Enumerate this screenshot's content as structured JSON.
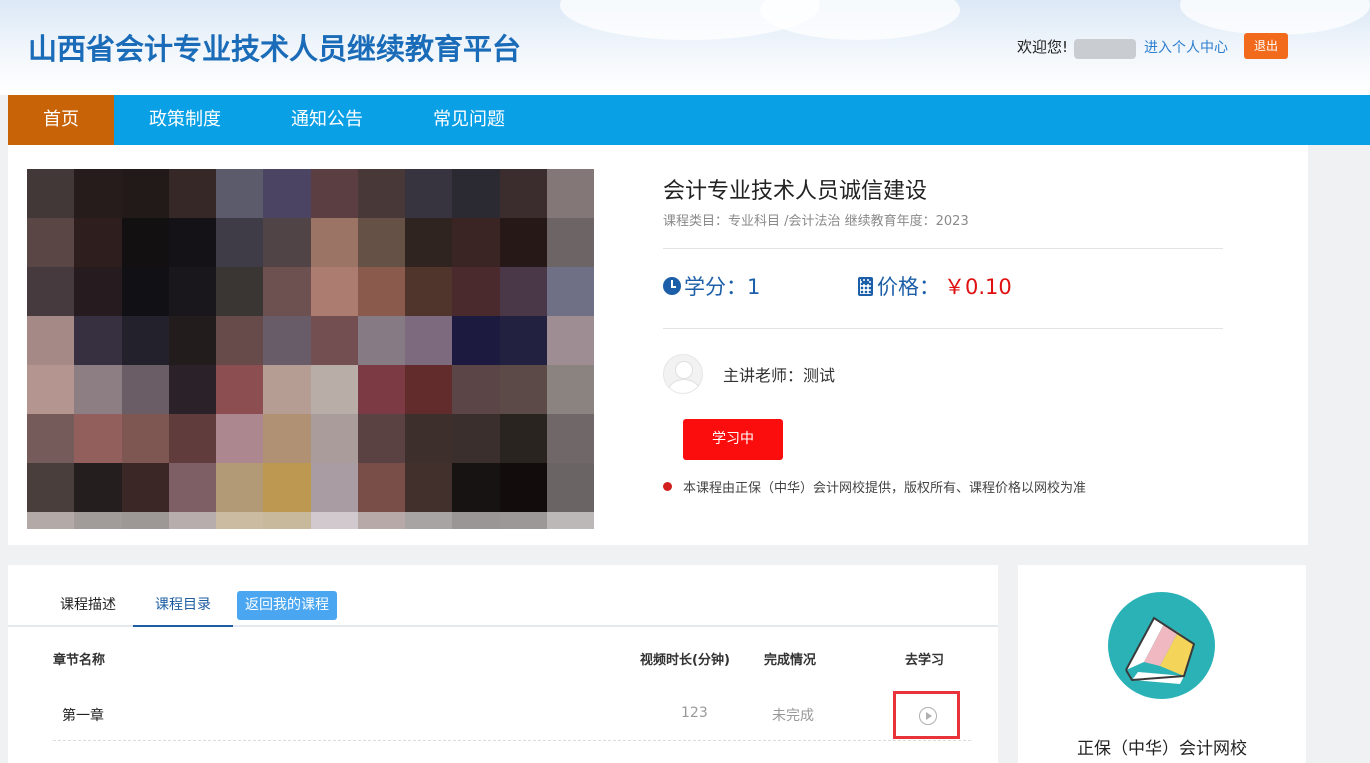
{
  "header": {
    "site_title": "山西省会计专业技术人员继续教育平台",
    "welcome": "欢迎您!",
    "user_center_link": "进入个人中心",
    "logout_label": "退出"
  },
  "nav": {
    "items": [
      {
        "label": "首页",
        "active": true
      },
      {
        "label": "政策制度",
        "active": false
      },
      {
        "label": "通知公告",
        "active": false
      },
      {
        "label": "常见问题",
        "active": false
      }
    ]
  },
  "course": {
    "title": "会计专业技术人员诚信建设",
    "meta": "课程类目：专业科目 /会计法治  继续教育年度：2023",
    "credit_label": "学分：1",
    "price_label": "价格：",
    "price_value": "￥0.10",
    "teacher": "主讲老师：测试",
    "study_button": "学习中",
    "notice": "本课程由正保（中华）会计网校提供，版权所有、课程价格以网校为准",
    "thumbnail_colors": [
      "#423838",
      "#251c1b",
      "#221a19",
      "#352827",
      "#5c5b6b",
      "#4b4463",
      "#5b3e41",
      "#483837",
      "#373440",
      "#2b2a33",
      "#3b2d2e",
      "#837877",
      "#5b4646",
      "#2e1e1e",
      "#121011",
      "#141216",
      "#3f3b47",
      "#514446",
      "#9b7465",
      "#665146",
      "#2f2420",
      "#3a2424",
      "#261817",
      "#6d6565",
      "#473a3f",
      "#261b1e",
      "#111015",
      "#19171b",
      "#3a3634",
      "#6d5050",
      "#ad7c70",
      "#8a5a4d",
      "#50352d",
      "#4a2a2c",
      "#4a3848",
      "#6f6f86",
      "#a48986",
      "#363041",
      "#23212c",
      "#221c1d",
      "#674a4a",
      "#675c67",
      "#734f51",
      "#867b85",
      "#7d6a7e",
      "#1d1a40",
      "#22213f",
      "#9e8e94",
      "#b59590",
      "#8c7e82",
      "#6a5d65",
      "#2a2228",
      "#8c4e51",
      "#b59d94",
      "#b9ada7",
      "#7c3a44",
      "#622b2c",
      "#5b4546",
      "#5c4a48",
      "#8a8380",
      "#755b59",
      "#925f5c",
      "#7f5752",
      "#603c3c",
      "#ad878f",
      "#b09173",
      "#aa9c9a",
      "#5a4142",
      "#3c2f2c",
      "#3a2f2c",
      "#2a2420",
      "#706868",
      "#4a3e3d",
      "#251e1e",
      "#3b2725",
      "#7f5f66",
      "#b29a77",
      "#bc9850",
      "#a99ca3",
      "#7a4e48",
      "#42302c",
      "#171313",
      "#120c0c",
      "#6a6464",
      "#b3aaa8",
      "#a19b9a",
      "#9d9796",
      "#b7adac",
      "#cbbba0",
      "#c8b99c",
      "#d1c9ce",
      "#b6a9a7",
      "#a8a4a4",
      "#9a9696",
      "#9d9898",
      "#bdb8b8"
    ]
  },
  "tabs": {
    "desc": "课程描述",
    "catalog": "课程目录",
    "back": "返回我的课程"
  },
  "catalog": {
    "headers": {
      "chapter": "章节名称",
      "duration": "视频时长(分钟)",
      "status": "完成情况",
      "go": "去学习"
    },
    "rows": [
      {
        "chapter": "第一章",
        "duration": "123",
        "status": "未完成"
      }
    ]
  },
  "school": {
    "name": "正保（中华）会计网校"
  },
  "colors": {
    "nav_bg": "#0aa0e6",
    "nav_active": "#c96308",
    "title_blue": "#1a6cb8",
    "price_red": "#e01010",
    "study_red": "#fc0d0d",
    "logout_orange": "#f26a1b"
  }
}
